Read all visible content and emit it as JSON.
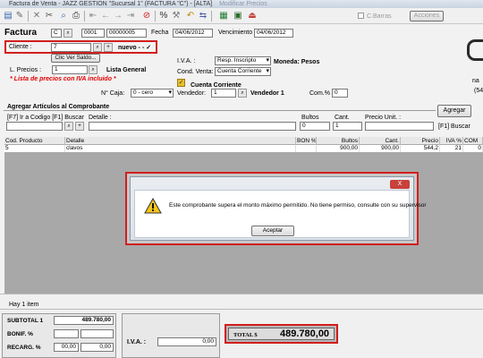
{
  "window": {
    "title": "Factura de Venta - JAZZ GESTION \"Sucursal 1\" (FACTURA \"C\") - [ALTA]",
    "title_suffix": "Modificar Precios"
  },
  "toolbar": {
    "icons": [
      "new-doc-icon",
      "edit-icon",
      "delete-icon",
      "cut-icon",
      "search-icon",
      "print-icon",
      "first-icon",
      "prev-icon",
      "next-icon",
      "last-icon",
      "cancel-icon",
      "percent-icon",
      "tools-icon",
      "undo-icon",
      "report-icon",
      "excel-icon",
      "calc-icon",
      "exit-icon"
    ],
    "check1_label": "C.Barras",
    "acciones_label": "Acciones"
  },
  "header": {
    "doc_label": "Factura",
    "letter": "C",
    "point": "0001",
    "number": "00000005",
    "fecha_label": "Fecha",
    "fecha_value": "04/06/2012",
    "venc_label": "Vencimiento",
    "venc_value": "04/06/2012"
  },
  "cliente": {
    "label": "Cliente :",
    "value": "7",
    "nuevo": "nuevo -",
    "extra": "- ✓",
    "saldo_btn": "Clic Ver Saldo..."
  },
  "iva_section": {
    "iva_label": "I.V.A. :",
    "iva_value": "Resp. Inscripto",
    "cond_label": "Cond. Venta:",
    "cond_value": "Cuenta Corriente",
    "moneda": "Moneda: Pesos",
    "cc_label": "Cuenta Corriente"
  },
  "precios": {
    "label": "L. Precios :",
    "value": "1",
    "lista": "Lista General",
    "warning": "* Lista de precios con IVA incluido *"
  },
  "caja": {
    "label": "N° Caja:",
    "value": "0 - cero",
    "vendedor_label": "Vendedor:",
    "vendedor_value": "1",
    "vendedor_name": "Vendedor 1",
    "com_label": "Com.% :",
    "com_value": "0"
  },
  "right_edge": {
    "na": "na",
    "num": "(54"
  },
  "agregar": {
    "title": "Agregar Artículos al Comprobante",
    "hint": "[F7] Ir a Codigo [F1] Buscar",
    "detalle_label": "Detalle :",
    "bultos_label": "Bultos",
    "bultos_value": "0",
    "cant_label": "Cant.",
    "cant_value": "1",
    "precio_label": "Precio Unit. :",
    "agregar_btn": "Agregar",
    "f1_buscar": "[F1] Buscar"
  },
  "grid": {
    "headers": [
      "Cod. Producto",
      "Detalle",
      "BON %",
      "Bultos",
      "Cant.",
      "Precio",
      "IVA %",
      "COM"
    ],
    "rows": [
      [
        "5",
        "clavos",
        "",
        "900,00",
        "900,00",
        "544,2",
        "21",
        "0"
      ]
    ]
  },
  "dialog": {
    "close": "X",
    "message": "Este comprobante supera el monto máximo permitido. No tiene permiso, consulte con su supervisor",
    "button": "Aceptar"
  },
  "footer": {
    "items_count": "Hay 1 item",
    "subtotal_label": "SUBTOTAL 1",
    "subtotal_value": "489.780,00",
    "bonif_label": "BONIF. %",
    "recarg_label": "RECARG. %",
    "recarg_pct": "00,00",
    "recarg_value": "0,00",
    "iva_label": "I.V.A. :",
    "iva_value": "0,00",
    "total_label": "TOTAL $",
    "total_value": "489.780,00"
  }
}
